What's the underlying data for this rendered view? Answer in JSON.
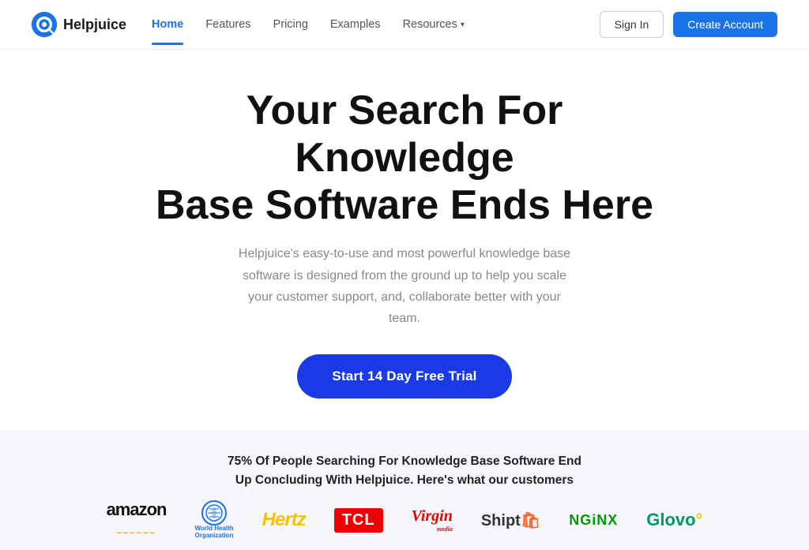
{
  "nav": {
    "logo_text": "Helpjuice",
    "links": [
      {
        "label": "Home",
        "active": true
      },
      {
        "label": "Features",
        "active": false
      },
      {
        "label": "Pricing",
        "active": false
      },
      {
        "label": "Examples",
        "active": false
      },
      {
        "label": "Resources",
        "active": false,
        "hasDropdown": true
      }
    ],
    "signin_label": "Sign In",
    "create_account_label": "Create Account"
  },
  "hero": {
    "headline_line1": "Your Search For Knowledge",
    "headline_line2": "Base Software Ends Here",
    "subtext": "Helpjuice's easy-to-use and most powerful knowledge base software is designed from the ground up to help you scale your customer support, and, collaborate better with your team.",
    "cta_label": "Start 14 Day Free Trial"
  },
  "social_proof": {
    "text_line1": "75% Of People Searching For Knowledge Base Software End",
    "text_line2": "Up Concluding With Helpjuice. Here's what our customers",
    "logos": [
      {
        "name": "amazon",
        "display": "amazon"
      },
      {
        "name": "world-health-organization",
        "display": "WHO"
      },
      {
        "name": "hertz",
        "display": "Hertz"
      },
      {
        "name": "tcl",
        "display": "TCL"
      },
      {
        "name": "virgin",
        "display": "Virgin"
      },
      {
        "name": "shipt",
        "display": "Shipt"
      },
      {
        "name": "nginx",
        "display": "NGINX"
      },
      {
        "name": "glovo",
        "display": "Glovo"
      }
    ]
  }
}
